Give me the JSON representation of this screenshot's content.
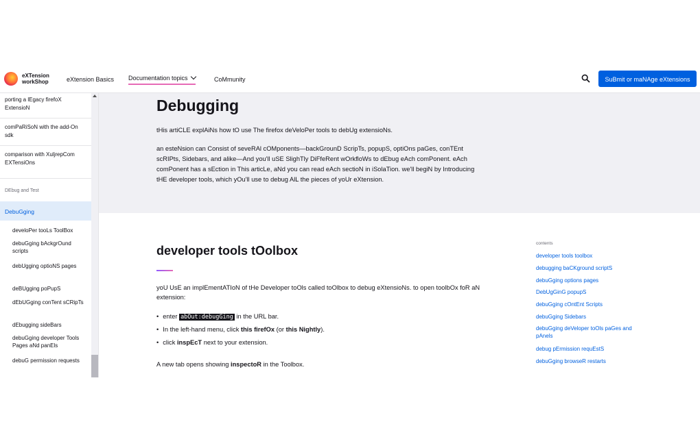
{
  "header": {
    "brand_line1": "eXTension",
    "brand_line2": "workShop",
    "nav": [
      "eXtension Basics",
      "Documentation topics",
      "CoMmunity"
    ],
    "cta": "SuBmit or maNAge eXtensions"
  },
  "sidebar": {
    "items": [
      "porting a lEgacy firefoX ExtensioN",
      "comPaRiSoN with the add-On sdk",
      "comparison with XuljrepCom EXTensiOns"
    ],
    "group": "DEbug and Test",
    "active": "DebuGging",
    "sub": [
      "develoPer tooLs ToolBox",
      "debuGging bAckgrOund scripts",
      "debUgging optioNS pages",
      "deBUgging poPupS",
      "dEbUGging conTent sCRipTs",
      "dEbugging sideBars",
      "debuGging developer Tools Pages aNd panEls",
      "debuG permission requests"
    ]
  },
  "hero": {
    "title": "Debugging",
    "intro": "tHis artiCLE explAiNs how tO use The firefox deVeloPer tools to debUg extensioNs.",
    "para_lines": [
      "an esteNsion can Consist of seveRAl cOMponents—backGrounD ScripTs, popupS, optiOns paGes, conTEnt",
      "scRIPts, Sidebars, and alike—And you'll uSE SlighTly DiFfeRent wOrkfloWs to dEbug eAch comPonent. eAch",
      "comPonent has a sEction in This articLe, aNd you can read eAch sectioN in iSolaTion. we'll begiN by Introducing",
      "tHE developer tools, which yOu'll use to debug AlL the pieces of yoUr eXtension."
    ]
  },
  "main": {
    "heading": "developer tools tOolbox",
    "para_line1": "yoU UsE an implEmentATIoN of tHe Developer toOls called toOlbox to debug eXtensioNs. to open toolbOx foR aN",
    "para_line2": "extension:",
    "b1_pre": "enter",
    "b1_code": "abOut:debugGing",
    "b1_post": "in the URL bar.",
    "b2_pre": "In the left-hand menu, click",
    "b2_bold1": "this firefOx",
    "b2_mid": "(or",
    "b2_bold2": "this Nightly",
    "b2_post": ").",
    "b3_pre": "click",
    "b3_bold": "inspEcT",
    "b3_post": "next to your extension.",
    "last_pre": "A new tab opens showing",
    "last_bold": "inspectoR",
    "last_post": "in the Toolbox."
  },
  "toc": {
    "heading": "contents",
    "items": [
      "developer tools toolbox",
      "debugging baCKground scriptS",
      "debuGging options pages",
      "DebUgGinG popupS",
      "debuGging cOntEnt Scripts",
      "debuGging Sidebars",
      "debuGging deVeloper toOls paGes and pAnels",
      "debug pErmission requEstS",
      "debuGging browseR restarts"
    ]
  }
}
